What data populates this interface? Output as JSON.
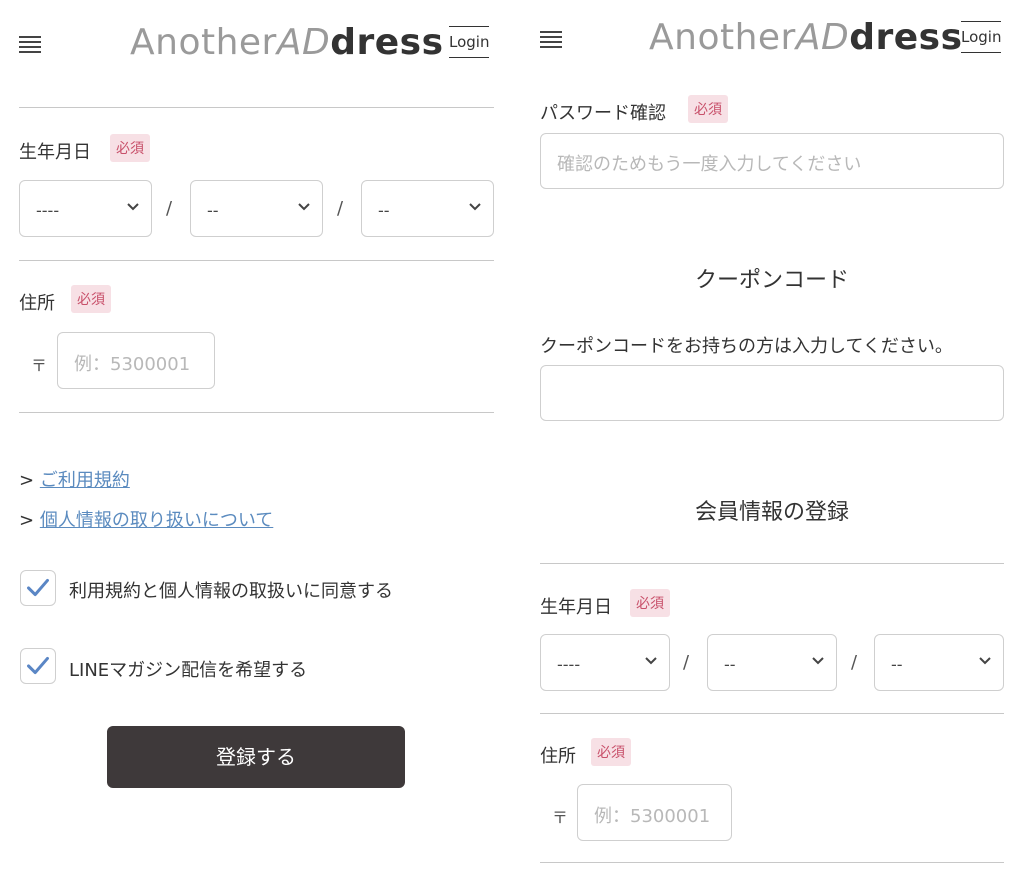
{
  "header": {
    "logo_part1": "Another",
    "logo_part2": "AD",
    "logo_part3": "dress",
    "login_label": "Login"
  },
  "left": {
    "birthdate": {
      "label": "生年月日",
      "required": "必須",
      "year_value": "----",
      "month_value": "--",
      "day_value": "--",
      "separator": "/"
    },
    "address": {
      "label": "住所",
      "required": "必須",
      "postal_mark": "〒",
      "postal_placeholder": "例：5300001"
    },
    "links": {
      "prefix": ">",
      "terms": "ご利用規約",
      "privacy": "個人情報の取り扱いについて"
    },
    "checkboxes": {
      "agree": "利用規約と個人情報の取扱いに同意する",
      "line": "LINEマガジン配信を希望する"
    },
    "submit_label": "登録する"
  },
  "right": {
    "password_confirm": {
      "label": "パスワード確認",
      "required": "必須",
      "placeholder": "確認のためもう一度入力してください"
    },
    "coupon": {
      "title": "クーポンコード",
      "note": "クーポンコードをお持ちの方は入力してください。"
    },
    "member_title": "会員情報の登録",
    "birthdate": {
      "label": "生年月日",
      "required": "必須",
      "year_value": "----",
      "month_value": "--",
      "day_value": "--",
      "separator": "/"
    },
    "address": {
      "label": "住所",
      "required": "必須",
      "postal_mark": "〒",
      "postal_placeholder": "例：5300001"
    }
  },
  "colors": {
    "required_text": "#c8506a",
    "required_bg": "#f7e0e5",
    "link": "#5b8bbf",
    "checkmark": "#5a86c5",
    "submit_bg": "#3e393a"
  },
  "icons": [
    "hamburger-menu-icon",
    "chevron-down-icon",
    "checkmark-icon"
  ]
}
